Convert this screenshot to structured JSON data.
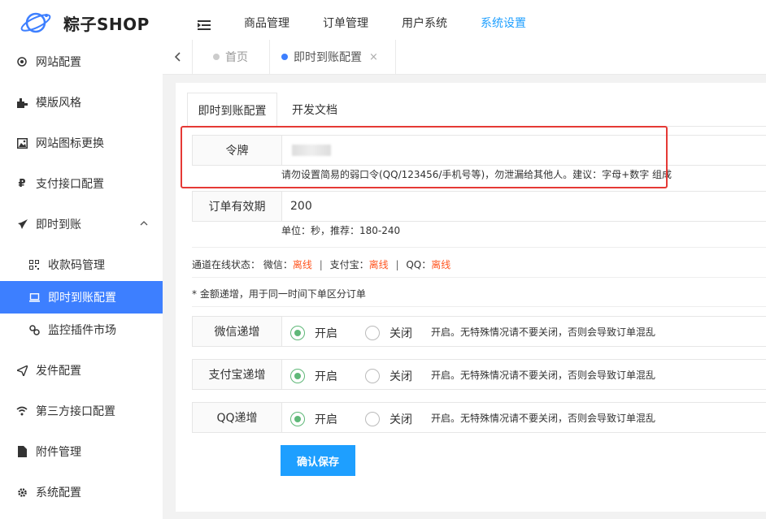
{
  "app": {
    "title": "粽子SHOP"
  },
  "topnav": [
    "商品管理",
    "订单管理",
    "用户系统",
    "系统设置"
  ],
  "sidebar": {
    "items": [
      {
        "label": "网站配置",
        "icon": "target-icon"
      },
      {
        "label": "模版风格",
        "icon": "puzzle-icon"
      },
      {
        "label": "网站图标更换",
        "icon": "image-icon"
      },
      {
        "label": "支付接口配置",
        "icon": "yen-icon"
      },
      {
        "label": "即时到账",
        "icon": "rocket-icon"
      },
      {
        "label": "收款码管理",
        "icon": "qrcode-icon"
      },
      {
        "label": "即时到账配置",
        "icon": "laptop-icon"
      },
      {
        "label": "监控插件市场",
        "icon": "link-icon"
      },
      {
        "label": "发件配置",
        "icon": "send-icon"
      },
      {
        "label": "第三方接口配置",
        "icon": "wifi-icon"
      },
      {
        "label": "附件管理",
        "icon": "file-icon"
      },
      {
        "label": "系统配置",
        "icon": "gear-icon"
      }
    ]
  },
  "tabs": {
    "home": "首页",
    "current": "即时到账配置",
    "close": "×"
  },
  "content_tabs": [
    "即时到账配置",
    "开发文档"
  ],
  "form": {
    "token": {
      "label": "令牌",
      "hint": "请勿设置简易的弱口令(QQ/123456/手机号等)，勿泄漏给其他人。建议：字母+数字 组成"
    },
    "expiry": {
      "label": "订单有效期",
      "value": "200",
      "hint": "单位：秒，推荐：180-240"
    },
    "status": {
      "prefix": "通道在线状态：",
      "wechat_label": "微信：",
      "wechat_value": "离线",
      "alipay_label": "支付宝：",
      "alipay_value": "离线",
      "qq_label": "QQ：",
      "qq_value": "离线",
      "sep": "|"
    },
    "note": "* 金额递增，用于同一时间下单区分订单",
    "increments": [
      {
        "label": "微信递增",
        "on": "开启",
        "off": "关闭",
        "selected": "on",
        "desc": "开启。无特殊情况请不要关闭，否则会导致订单混乱"
      },
      {
        "label": "支付宝递增",
        "on": "开启",
        "off": "关闭",
        "selected": "on",
        "desc": "开启。无特殊情况请不要关闭，否则会导致订单混乱"
      },
      {
        "label": "QQ递增",
        "on": "开启",
        "off": "关闭",
        "selected": "on",
        "desc": "开启。无特殊情况请不要关闭，否则会导致订单混乱"
      }
    ],
    "save": "确认保存"
  },
  "colors": {
    "accent": "#1e9fff",
    "sidebar_active": "#3d7fff",
    "offline": "#ff5722",
    "radio_on": "#5fb878",
    "highlight_box": "#e53935"
  }
}
